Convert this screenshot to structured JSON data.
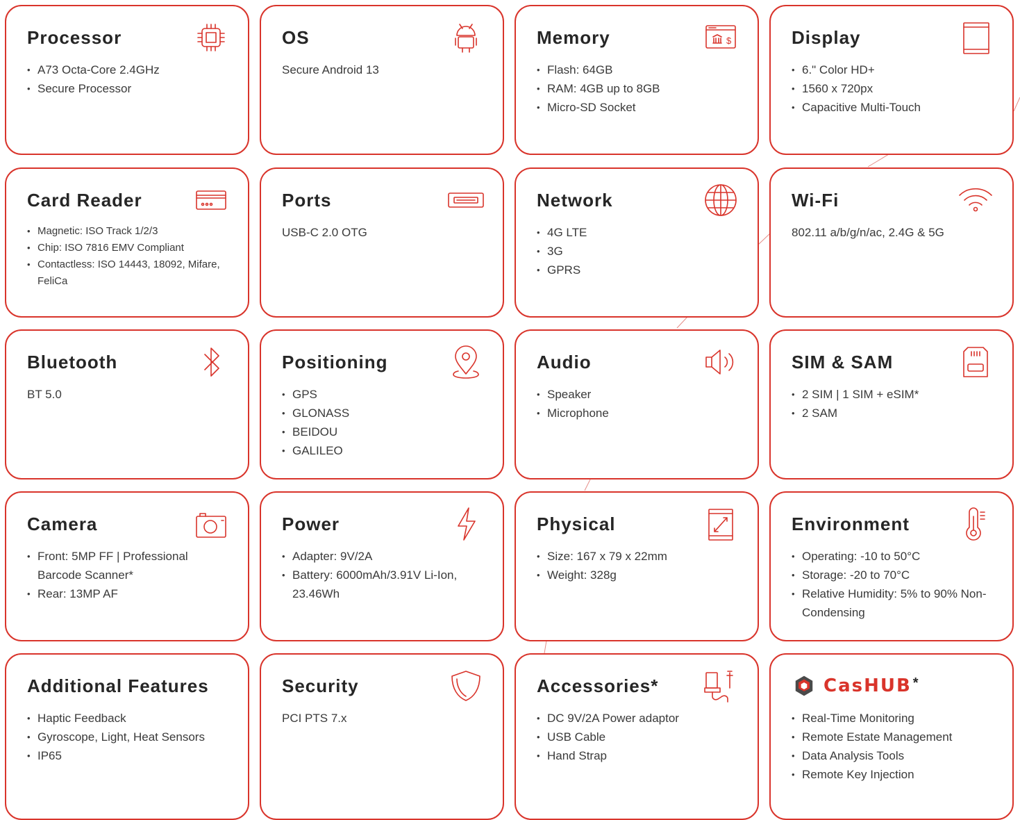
{
  "theme": {
    "accent": "#d9342b",
    "text": "#262626"
  },
  "cards": [
    {
      "title": "Processor",
      "icon": "chip-icon",
      "bullets": [
        "A73 Octa-Core 2.4GHz",
        "Secure Processor"
      ]
    },
    {
      "title": "OS",
      "icon": "android-icon",
      "text": "Secure Android 13"
    },
    {
      "title": "Memory",
      "icon": "memory-card-icon",
      "bullets": [
        "Flash: 64GB",
        "RAM: 4GB up to 8GB",
        "Micro-SD Socket"
      ]
    },
    {
      "title": "Display",
      "icon": "display-icon",
      "bullets": [
        "6.\" Color HD+",
        "1560 x 720px",
        "Capacitive Multi-Touch"
      ]
    },
    {
      "title": "Card Reader",
      "icon": "card-reader-icon",
      "bullets": [
        "Magnetic: ISO Track 1/2/3",
        "Chip: ISO 7816 EMV Compliant",
        "Contactless: ISO 14443, 18092, Mifare, FeliCa"
      ]
    },
    {
      "title": "Ports",
      "icon": "usb-port-icon",
      "text": "USB-C 2.0 OTG"
    },
    {
      "title": "Network",
      "icon": "globe-icon",
      "bullets": [
        "4G LTE",
        "3G",
        "GPRS"
      ]
    },
    {
      "title": "Wi-Fi",
      "icon": "wifi-icon",
      "text": "802.11 a/b/g/n/ac, 2.4G & 5G"
    },
    {
      "title": "Bluetooth",
      "icon": "bluetooth-icon",
      "text": "BT 5.0"
    },
    {
      "title": "Positioning",
      "icon": "location-pin-icon",
      "bullets": [
        "GPS",
        "GLONASS",
        "BEIDOU",
        "GALILEO"
      ]
    },
    {
      "title": "Audio",
      "icon": "speaker-icon",
      "bullets": [
        "Speaker",
        "Microphone"
      ]
    },
    {
      "title": "SIM & SAM",
      "icon": "sim-card-icon",
      "bullets": [
        "2 SIM | 1 SIM + eSIM*",
        "2 SAM"
      ]
    },
    {
      "title": "Camera",
      "icon": "camera-icon",
      "bullets": [
        "Front: 5MP FF | Professional Barcode Scanner*",
        "Rear: 13MP AF"
      ]
    },
    {
      "title": "Power",
      "icon": "lightning-icon",
      "bullets": [
        "Adapter: 9V/2A",
        "Battery: 6000mAh/3.91V Li-Ion, 23.46Wh"
      ]
    },
    {
      "title": "Physical",
      "icon": "dimensions-icon",
      "bullets": [
        "Size: 167 x 79 x 22mm",
        "Weight: 328g"
      ]
    },
    {
      "title": "Environment",
      "icon": "thermometer-icon",
      "bullets": [
        "Operating: -10 to 50°C",
        "Storage: -20 to 70°C",
        "Relative Humidity: 5% to 90% Non-Condensing"
      ]
    },
    {
      "title": "Additional Features",
      "bullets": [
        "Haptic Feedback",
        "Gyroscope, Light, Heat Sensors",
        "IP65"
      ]
    },
    {
      "title": "Security",
      "icon": "shield-icon",
      "text": "PCI PTS 7.x"
    },
    {
      "title": "Accessories*",
      "icon": "charger-icon",
      "bullets": [
        "DC 9V/2A Power adaptor",
        "USB Cable",
        "Hand Strap"
      ]
    },
    {
      "brand": "CasHUB",
      "brand_mark": "*",
      "icon": "cashub-logo-icon",
      "bullets": [
        "Real-Time Monitoring",
        "Remote Estate Management",
        "Data Analysis Tools",
        "Remote Key Injection"
      ]
    }
  ]
}
